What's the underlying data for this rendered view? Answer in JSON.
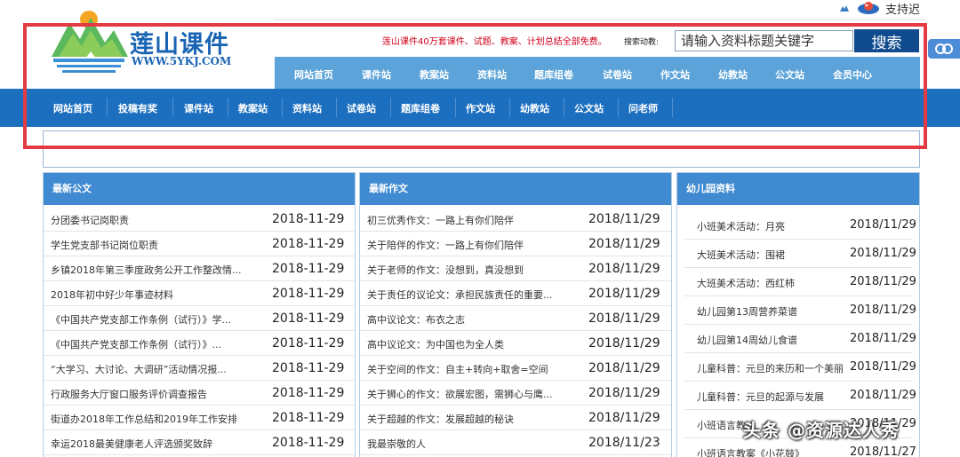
{
  "support_text": "支持迟",
  "logo": {
    "name": "莲山课件",
    "url": "WWW.5YKJ.COM"
  },
  "promo": "莲山课件40万套课件、试题、教案、计划总结全部免费。",
  "search": {
    "label": "搜索动教:",
    "placeholder": "请输入资料标题关键字",
    "button": "搜索"
  },
  "share_label": "∞",
  "nav_main": [
    "网站首页",
    "课件站",
    "教案站",
    "资料站",
    "题库组卷",
    "试卷站",
    "作文站",
    "幼教站",
    "公文站",
    "会员中心"
  ],
  "nav_sub": [
    "网站首页",
    "投稿有奖",
    "课件站",
    "教案站",
    "资料站",
    "试卷站",
    "题库组卷",
    "作文站",
    "幼教站",
    "公文站",
    "问老师"
  ],
  "panels": {
    "gongwen": {
      "title": "最新公文",
      "items": [
        {
          "title": "分团委书记岗职责",
          "date": "2018-11-29"
        },
        {
          "title": "学生党支部书记岗位职责",
          "date": "2018-11-29"
        },
        {
          "title": "乡镇2018年第三季度政务公开工作整改情...",
          "date": "2018-11-29"
        },
        {
          "title": "2018年初中好少年事迹材料",
          "date": "2018-11-29"
        },
        {
          "title": "《中国共产党支部工作条例（试行）》学...",
          "date": "2018-11-29"
        },
        {
          "title": "《中国共产党支部工作条例（试行）》...",
          "date": "2018-11-29"
        },
        {
          "title": "“大学习、大讨论、大调研”活动情况报...",
          "date": "2018-11-29"
        },
        {
          "title": "行政服务大厅窗口服务评价调查报告",
          "date": "2018-11-29"
        },
        {
          "title": "街道办2018年工作总结和2019年工作安排",
          "date": "2018-11-29"
        },
        {
          "title": "幸运2018最美健康老人评选颁奖致辞",
          "date": "2018-11-29"
        }
      ]
    },
    "zuowen": {
      "title": "最新作文",
      "items": [
        {
          "title": "初三优秀作文：一路上有你们陪伴",
          "date": "2018/11/29"
        },
        {
          "title": "关于陪伴的作文：一路上有你们陪伴",
          "date": "2018/11/29"
        },
        {
          "title": "关于老师的作文：没想到，真没想到",
          "date": "2018/11/29"
        },
        {
          "title": "关于责任的议论文：承担民族责任的重要...",
          "date": "2018/11/29"
        },
        {
          "title": "高中议论文：布衣之志",
          "date": "2018/11/29"
        },
        {
          "title": "高中议论文：为中国也为全人类",
          "date": "2018/11/29"
        },
        {
          "title": "关于空间的作文：自主+转向+取舍=空间",
          "date": "2018/11/29"
        },
        {
          "title": "关于狮心的作文：欲展宏图，需狮心与鹰...",
          "date": "2018/11/29"
        },
        {
          "title": "关于超越的作文：发展超越的秘诀",
          "date": "2018/11/29"
        },
        {
          "title": "我最崇敬的人",
          "date": "2018/11/23"
        }
      ]
    },
    "youer": {
      "title": "幼儿园资料",
      "items": [
        {
          "title": "小班美术活动：月亮",
          "date": "2018/11/29"
        },
        {
          "title": "大班美术活动：围裙",
          "date": "2018/11/29"
        },
        {
          "title": "大班美术活动：西红柿",
          "date": "2018/11/29"
        },
        {
          "title": "幼儿园第13周营养菜谱",
          "date": "2018/11/29"
        },
        {
          "title": "幼儿园第14周幼儿食谱",
          "date": "2018/11/29"
        },
        {
          "title": "儿童科普：元旦的来历和一个美丽",
          "date": "2018/11/29"
        },
        {
          "title": "儿童科普：元旦的起源与发展",
          "date": "2018/11/29"
        },
        {
          "title": "小班语言教",
          "date": "2018/11/29"
        },
        {
          "title": "小班语言教案《小花鼓》",
          "date": "2018/11/27"
        }
      ]
    }
  },
  "watermark": "头条 @资源达人秀",
  "colors": {
    "nav_main": "#5ba3d8",
    "nav_sub": "#1c6fbf",
    "panel_head": "#3f8ad0",
    "highlight_frame": "#e33a44",
    "promo": "#d0021b"
  }
}
